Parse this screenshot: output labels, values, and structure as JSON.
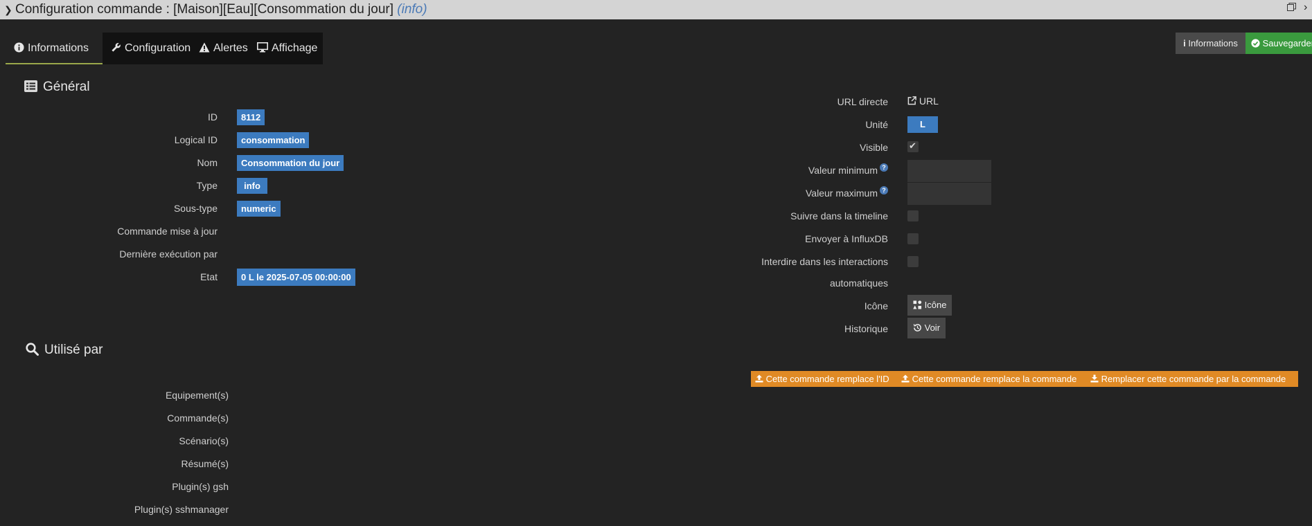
{
  "window": {
    "title": "Configuration commande : [Maison][Eau][Consommation du jour]",
    "title_suffix": "(info)"
  },
  "tabs": [
    {
      "label": "Informations",
      "icon": "info-circle-icon",
      "active": true
    },
    {
      "label": "Configuration",
      "icon": "wrench-icon",
      "active": false
    },
    {
      "label": "Alertes",
      "icon": "warning-icon",
      "active": false
    },
    {
      "label": "Affichage",
      "icon": "monitor-icon",
      "active": false
    }
  ],
  "toolbar": {
    "info_label": "Informations",
    "save_label": "Sauvegarder"
  },
  "general": {
    "title": "Général",
    "fields": {
      "id": {
        "label": "ID",
        "value": "8112"
      },
      "logical_id": {
        "label": "Logical ID",
        "value": "consommation"
      },
      "name": {
        "label": "Nom",
        "value": "Consommation du jour"
      },
      "type": {
        "label": "Type",
        "value": "info"
      },
      "subtype": {
        "label": "Sous-type",
        "value": "numeric"
      },
      "update_cmd": {
        "label": "Commande mise à jour"
      },
      "last_exec": {
        "label": "Dernière exécution par"
      },
      "state": {
        "label": "Etat",
        "value": "0 L le 2025-07-05 00:00:00"
      }
    }
  },
  "right": {
    "url": {
      "label": "URL directe",
      "link": "URL"
    },
    "unit": {
      "label": "Unité",
      "value": "L"
    },
    "visible": {
      "label": "Visible",
      "checked": true
    },
    "min": {
      "label": "Valeur minimum"
    },
    "max": {
      "label": "Valeur maximum"
    },
    "timeline": {
      "label": "Suivre dans la timeline",
      "checked": false
    },
    "influx": {
      "label": "Envoyer à InfluxDB",
      "checked": false
    },
    "interactions": {
      "label_line1": "Interdire dans les interactions",
      "label_line2": "automatiques",
      "checked": false
    },
    "icon": {
      "label": "Icône",
      "button": "Icône"
    },
    "history": {
      "label": "Historique",
      "button": "Voir"
    }
  },
  "used_by": {
    "title": "Utilisé par",
    "items": [
      "Equipement(s)",
      "Commande(s)",
      "Scénario(s)",
      "Résumé(s)",
      "Plugin(s) gsh",
      "Plugin(s) sshmanager"
    ]
  },
  "actions": {
    "replace_id": "Cette commande remplace l'ID",
    "replace_cmd": "Cette commande remplace la commande",
    "replace_by": "Remplacer cette commande par la commande"
  },
  "colors": {
    "badge": "#3c7bbf",
    "save": "#3a9a3e",
    "orange": "#e08a25",
    "active_tab_underline": "#9aa84a"
  }
}
